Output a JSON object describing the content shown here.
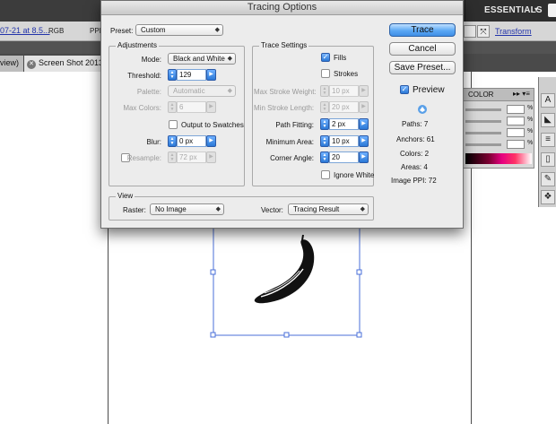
{
  "app_bar": {
    "workspace_label": "ESSENTIALS",
    "workspace_chevron": "▾"
  },
  "control_bar": {
    "filename_link": "07-21 at 8.5...",
    "color_mode": "RGB",
    "ppi_label": "PPI",
    "transform_link": "Transform"
  },
  "document_tabs": {
    "previous_tab_fragment": "view)",
    "current_tab": "Screen Shot 2013-"
  },
  "color_panel": {
    "title": "COLOR",
    "menu_glyph": "▸▸ ▾≡",
    "percent_sign": "%"
  },
  "dialog": {
    "title": "Tracing Options",
    "preset_label": "Preset:",
    "preset_value": "Custom",
    "adjustments": {
      "title": "Adjustments",
      "mode_label": "Mode:",
      "mode_value": "Black and White",
      "threshold_label": "Threshold:",
      "threshold_value": "129",
      "palette_label": "Palette:",
      "palette_value": "Automatic",
      "max_colors_label": "Max Colors:",
      "max_colors_value": "6",
      "output_to_swatches_label": "Output to Swatches",
      "blur_label": "Blur:",
      "blur_value": "0 px",
      "resample_label": "Resample:",
      "resample_value": "72 px"
    },
    "trace_settings": {
      "title": "Trace Settings",
      "fills_label": "Fills",
      "strokes_label": "Strokes",
      "max_stroke_weight_label": "Max Stroke Weight:",
      "max_stroke_weight_value": "10 px",
      "min_stroke_length_label": "Min Stroke Length:",
      "min_stroke_length_value": "20 px",
      "path_fitting_label": "Path Fitting:",
      "path_fitting_value": "2 px",
      "minimum_area_label": "Minimum Area:",
      "minimum_area_value": "10 px",
      "corner_angle_label": "Corner Angle:",
      "corner_angle_value": "20",
      "ignore_white_label": "Ignore White"
    },
    "view": {
      "title": "View",
      "raster_label": "Raster:",
      "raster_value": "No Image",
      "vector_label": "Vector:",
      "vector_value": "Tracing Result"
    },
    "buttons": {
      "trace": "Trace",
      "cancel": "Cancel",
      "save_preset": "Save Preset..."
    },
    "preview_label": "Preview",
    "stats": {
      "paths": "Paths: 7",
      "anchors": "Anchors: 61",
      "colors": "Colors: 2",
      "areas": "Areas: 4",
      "image_ppi": "Image PPI: 72"
    },
    "checkbox_states": {
      "fills": true,
      "strokes": false,
      "output_to_swatches": false,
      "resample": false,
      "ignore_white": false,
      "preview": true
    }
  }
}
